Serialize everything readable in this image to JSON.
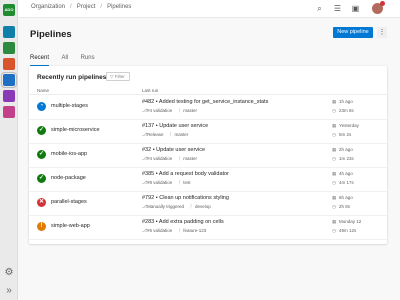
{
  "breadcrumb": [
    "Organization",
    "Project",
    "Pipelines"
  ],
  "rail_icons": [
    "azure-devops-logo-icon",
    "overview-icon",
    "boards-icon",
    "repos-icon",
    "pipelines-icon",
    "test-plans-icon",
    "artifacts-icon",
    "settings-icon",
    "collapse-icon"
  ],
  "page_title": "Pipelines",
  "new_pipeline_label": "New pipeline",
  "more_label": "⋮",
  "tabs": [
    {
      "label": "Recent",
      "active": true
    },
    {
      "label": "All",
      "active": false
    },
    {
      "label": "Runs",
      "active": false
    }
  ],
  "card": {
    "title": "Recently run pipelines",
    "filter_placeholder": "Filter",
    "col_name": "Name",
    "col_last_run": "Last run"
  },
  "colors": {
    "accent": "#0078d4",
    "running": "#0078d4",
    "success": "#107c10",
    "failed": "#d13438",
    "warning": "#e07a00"
  },
  "pipelines": [
    {
      "name": "multiple-stages",
      "status": "running",
      "run": "#482 • Added testing for get_service_instance_stats",
      "trigger": "#4 validation",
      "branch": "master",
      "when": "1h ago",
      "duration": "23m 8s"
    },
    {
      "name": "simple-microservice",
      "status": "success",
      "run": "#137 • Update user service",
      "trigger": "Release",
      "branch": "master",
      "when": "Yesterday",
      "duration": "5m 2s"
    },
    {
      "name": "mobile-ios-app",
      "status": "success",
      "run": "#32 • Update user service",
      "trigger": "#4 validation",
      "branch": "master",
      "when": "2h ago",
      "duration": "1m 23s"
    },
    {
      "name": "node-package",
      "status": "success",
      "run": "#385 • Add a request body validator",
      "trigger": "#8 validation",
      "branch": "test",
      "when": "4h ago",
      "duration": "4m 17s"
    },
    {
      "name": "parallel-stages",
      "status": "failed",
      "run": "#792 • Clean up notifications styling",
      "trigger": "Manually triggered",
      "branch": "develop",
      "when": "6h ago",
      "duration": "2h 8s"
    },
    {
      "name": "simple-web-app",
      "status": "warning",
      "run": "#283 • Add extra padding on cells",
      "trigger": "#6 validation",
      "branch": "feature-123",
      "when": "Monday 12",
      "duration": "49m 12s"
    }
  ]
}
